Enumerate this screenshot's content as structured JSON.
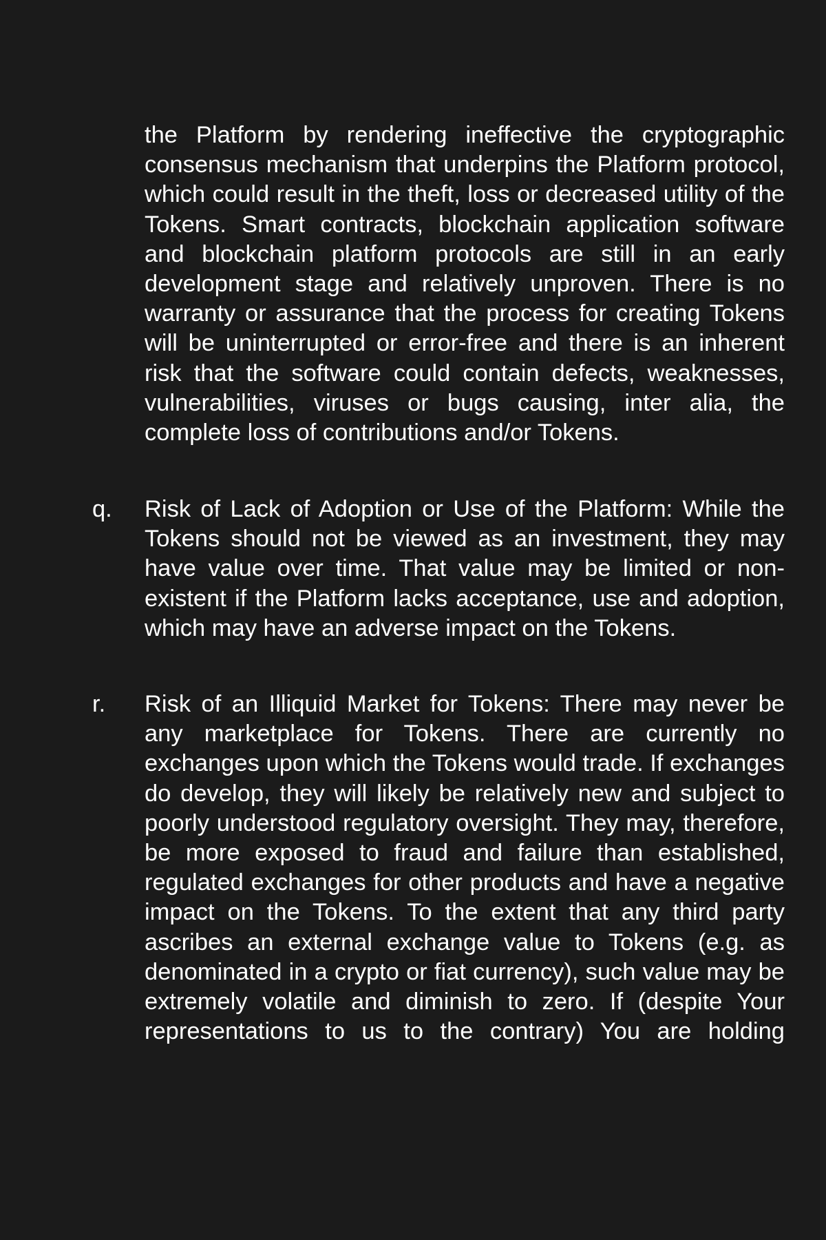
{
  "document": {
    "continuation_paragraph": "the Platform by rendering ineffective the cryptographic consensus mechanism that underpins the Platform protocol, which could result in the theft, loss or decreased utility of the Tokens. Smart contracts, blockchain application software and blockchain platform protocols are still in an early development stage and relatively unproven. There is no warranty or assurance that the process for creating Tokens will be uninterrupted or error-free and there is an inherent risk that the software could contain defects, weaknesses, vulnerabilities, viruses or bugs causing, inter alia, the complete loss of contributions and/or Tokens.",
    "items": [
      {
        "marker": "q.",
        "text": "Risk of Lack of Adoption or Use of the Platform: While the Tokens should not be viewed as an investment, they may have value over time. That value may be limited or non-existent if the Platform lacks acceptance, use and adoption, which may have an adverse impact on the Tokens."
      },
      {
        "marker": "r.",
        "text": "Risk of an Illiquid Market for Tokens: There may never be any marketplace for Tokens. There are currently no exchanges upon which the Tokens would trade. If exchanges do develop, they will likely be relatively new and subject to poorly understood regulatory oversight. They may, therefore, be more exposed to fraud and failure than established, regulated exchanges for other products and have a negative impact on the Tokens. To the extent that any third party ascribes an external exchange value to Tokens (e.g. as denominated in a crypto or fiat currency), such value may be extremely volatile and diminish to zero. If (despite Your representations to us to the contrary) You are holding"
      }
    ]
  }
}
